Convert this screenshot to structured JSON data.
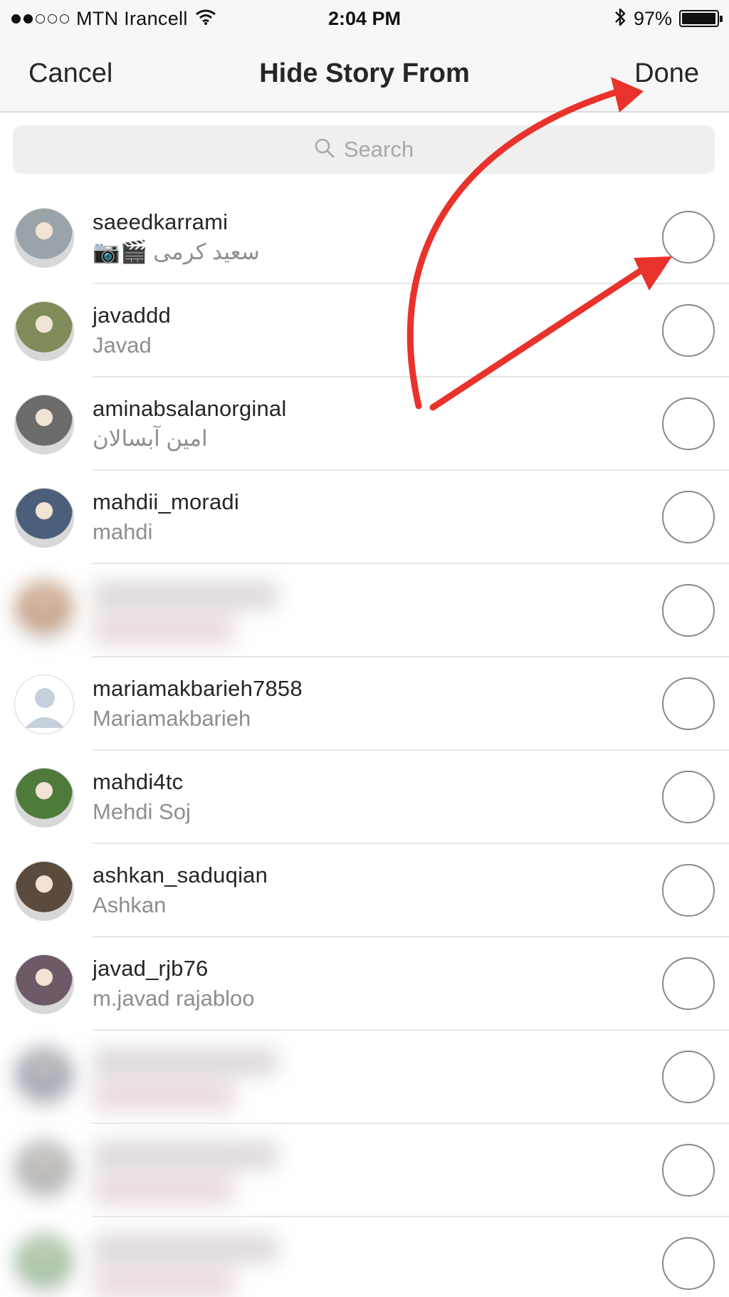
{
  "status_bar": {
    "carrier": "MTN Irancell",
    "time": "2:04 PM",
    "battery_percent": "97%",
    "battery_level": 0.97,
    "signal_bars": 2
  },
  "nav": {
    "cancel_label": "Cancel",
    "title": "Hide Story From",
    "done_label": "Done"
  },
  "search": {
    "placeholder": "Search"
  },
  "users": [
    {
      "username": "saeedkarrami",
      "full_name": "سعید کرمی",
      "emoji": "📷🎬",
      "selected": false,
      "blurred": false,
      "avatar_color": "#9aa3a8"
    },
    {
      "username": "javaddd",
      "full_name": "Javad",
      "emoji": "",
      "selected": false,
      "blurred": false,
      "avatar_color": "#7f8c5a"
    },
    {
      "username": "aminabsalanorginal",
      "full_name": "امین آبسالان",
      "emoji": "",
      "selected": false,
      "blurred": false,
      "avatar_color": "#6b6b6b"
    },
    {
      "username": "mahdii_moradi",
      "full_name": "mahdi",
      "emoji": "",
      "selected": false,
      "blurred": false,
      "avatar_color": "#4c5f7a"
    },
    {
      "username": "",
      "full_name": "",
      "emoji": "",
      "selected": false,
      "blurred": true,
      "avatar_color": "#b78a6a"
    },
    {
      "username": "mariamakbarieh7858",
      "full_name": "Mariamakbarieh",
      "emoji": "",
      "selected": false,
      "blurred": false,
      "avatar_color": "#c9d2e0"
    },
    {
      "username": "mahdi4tc",
      "full_name": "Mehdi Soj",
      "emoji": "",
      "selected": false,
      "blurred": false,
      "avatar_color": "#4e7a3a"
    },
    {
      "username": "ashkan_saduqian",
      "full_name": "Ashkan",
      "emoji": "",
      "selected": false,
      "blurred": false,
      "avatar_color": "#5a4b3c"
    },
    {
      "username": "javad_rjb76",
      "full_name": "m.javad rajabloo",
      "emoji": "",
      "selected": false,
      "blurred": false,
      "avatar_color": "#6d5a66"
    },
    {
      "username": "",
      "full_name": "",
      "emoji": "",
      "selected": false,
      "blurred": true,
      "avatar_color": "#8a8f9e"
    },
    {
      "username": "",
      "full_name": "",
      "emoji": "",
      "selected": false,
      "blurred": true,
      "avatar_color": "#a0a0a0"
    },
    {
      "username": "",
      "full_name": "",
      "emoji": "",
      "selected": false,
      "blurred": true,
      "avatar_color": "#8bb08a"
    }
  ],
  "colors": {
    "annotation_arrow": "#e8322b",
    "background": "#ffffff",
    "nav_background": "#f7f7f7",
    "secondary_text": "#8e8e8e"
  },
  "icons": [
    "wifi-icon",
    "bluetooth-icon",
    "battery-icon",
    "search-icon",
    "default-avatar-icon"
  ]
}
